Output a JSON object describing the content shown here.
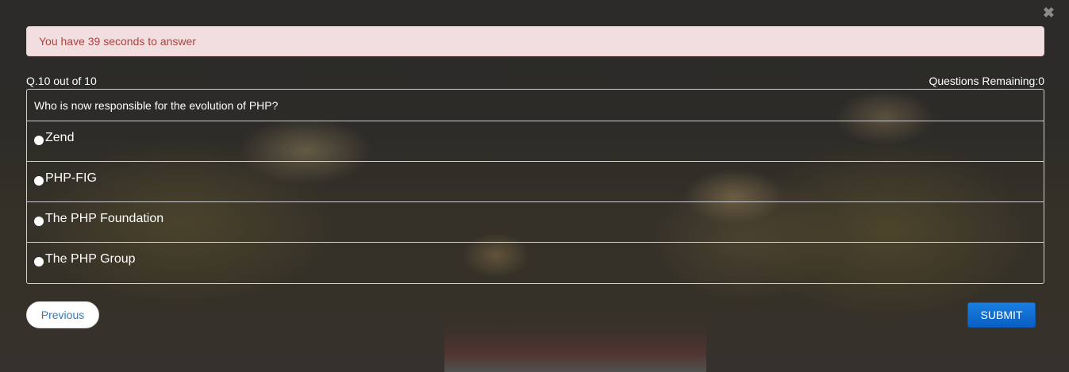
{
  "alert": {
    "text": "You have 39 seconds to answer"
  },
  "header": {
    "question_number": "Q.10 out of 10",
    "remaining": "Questions Remaining:0"
  },
  "question": {
    "text": "Who is now responsible for the evolution of PHP?",
    "options": [
      {
        "label": "Zend",
        "selected": false
      },
      {
        "label": "PHP-FIG",
        "selected": false
      },
      {
        "label": "The PHP Foundation",
        "selected": false
      },
      {
        "label": "The PHP Group",
        "selected": false
      }
    ]
  },
  "buttons": {
    "previous": "Previous",
    "submit": "SUBMIT"
  },
  "close_icon": "close-icon",
  "colors": {
    "alert_bg": "#f2dede",
    "alert_text": "#a94442",
    "submit_bg": "#0a6fd6",
    "previous_text": "#337ab7"
  }
}
